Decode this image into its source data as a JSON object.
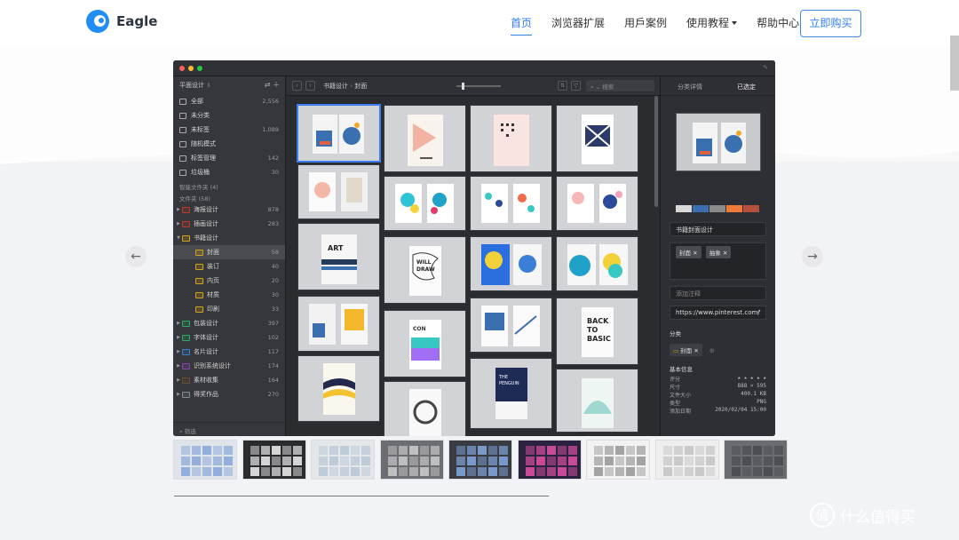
{
  "brand": {
    "name": "Eagle"
  },
  "nav": {
    "links": [
      "首页",
      "浏览器扩展",
      "用戶案例",
      "使用教程",
      "帮助中心"
    ],
    "buy_label": "立即购买"
  },
  "carousel": {
    "prev_icon": "arrow-left-icon",
    "next_icon": "arrow-right-icon",
    "prev_glyph": "←",
    "next_glyph": "→"
  },
  "app": {
    "library_name": "平面设计",
    "library_icon": "chevron-updown-icon",
    "items": [
      {
        "label": "全部",
        "count": "2,556",
        "icon": "all-items-icon"
      },
      {
        "label": "未分类",
        "count": "",
        "icon": "uncategorized-icon"
      },
      {
        "label": "未标签",
        "count": "1,089",
        "icon": "untagged-icon"
      },
      {
        "label": "随机模式",
        "count": "",
        "icon": "random-icon"
      },
      {
        "label": "标签管理",
        "count": "142",
        "icon": "tags-icon"
      },
      {
        "label": "垃圾桶",
        "count": "30",
        "icon": "trash-icon"
      }
    ],
    "smart_folders_label": "智能文件夹 (4)",
    "folders_label": "文件夹 (58)",
    "folders": [
      {
        "label": "海报设计",
        "count": "878",
        "color": "#c0392b",
        "level": 0,
        "expanded": false
      },
      {
        "label": "插画设计",
        "count": "283",
        "color": "#c0392b",
        "level": 0,
        "expanded": false
      },
      {
        "label": "书籍设计",
        "count": "",
        "color": "#d4a017",
        "level": 0,
        "expanded": true
      },
      {
        "label": "封面",
        "count": "58",
        "color": "#d4a017",
        "level": 1,
        "selected": true
      },
      {
        "label": "装订",
        "count": "40",
        "color": "#d4a017",
        "level": 1
      },
      {
        "label": "内页",
        "count": "20",
        "color": "#d4a017",
        "level": 1
      },
      {
        "label": "材质",
        "count": "30",
        "color": "#d4a017",
        "level": 1
      },
      {
        "label": "印刷",
        "count": "33",
        "color": "#d4a017",
        "level": 1
      },
      {
        "label": "包装设计",
        "count": "397",
        "color": "#27ae60",
        "level": 0,
        "expanded": false
      },
      {
        "label": "字体设计",
        "count": "102",
        "color": "#27ae60",
        "level": 0,
        "expanded": false
      },
      {
        "label": "名片设计",
        "count": "117",
        "color": "#3a7fd5",
        "level": 0,
        "expanded": false
      },
      {
        "label": "识别系统设计",
        "count": "174",
        "color": "#8e44ad",
        "level": 0,
        "expanded": false
      },
      {
        "label": "素材收集",
        "count": "164",
        "color": "#6b4f2a",
        "level": 0,
        "expanded": false
      },
      {
        "label": "得奖作品",
        "count": "270",
        "color": "#7f8c8d",
        "level": 0,
        "expanded": false
      }
    ],
    "filter_placeholder": "筛选",
    "breadcrumb": [
      "书籍设计",
      "封面"
    ],
    "search_placeholder": "搜索",
    "inspector": {
      "tabs": [
        "分类详情",
        "已选定"
      ],
      "palette": [
        "#d8d8d8",
        "#3a6fb0",
        "#8a8a8a",
        "#f07a3a",
        "#b5503a"
      ],
      "name": "书籍封面设计",
      "tags": [
        "封面",
        "抽象"
      ],
      "note_placeholder": "添加注释",
      "url": "https://www.pinterest.com/",
      "folder_section": "分类",
      "folder_tag": "封面",
      "info_section": "基本信息",
      "info": [
        {
          "key": "评分",
          "value": "★ ★ ★ ★ ★"
        },
        {
          "key": "尺寸",
          "value": "888 × 595"
        },
        {
          "key": "文件大小",
          "value": "400.1 KB"
        },
        {
          "key": "类型",
          "value": "PNG"
        },
        {
          "key": "添加日期",
          "value": "2020/02/04 15:00"
        }
      ]
    }
  },
  "watermark": {
    "text": "什么值得买",
    "icon": "zhi-logo-icon",
    "glyph": "值"
  }
}
